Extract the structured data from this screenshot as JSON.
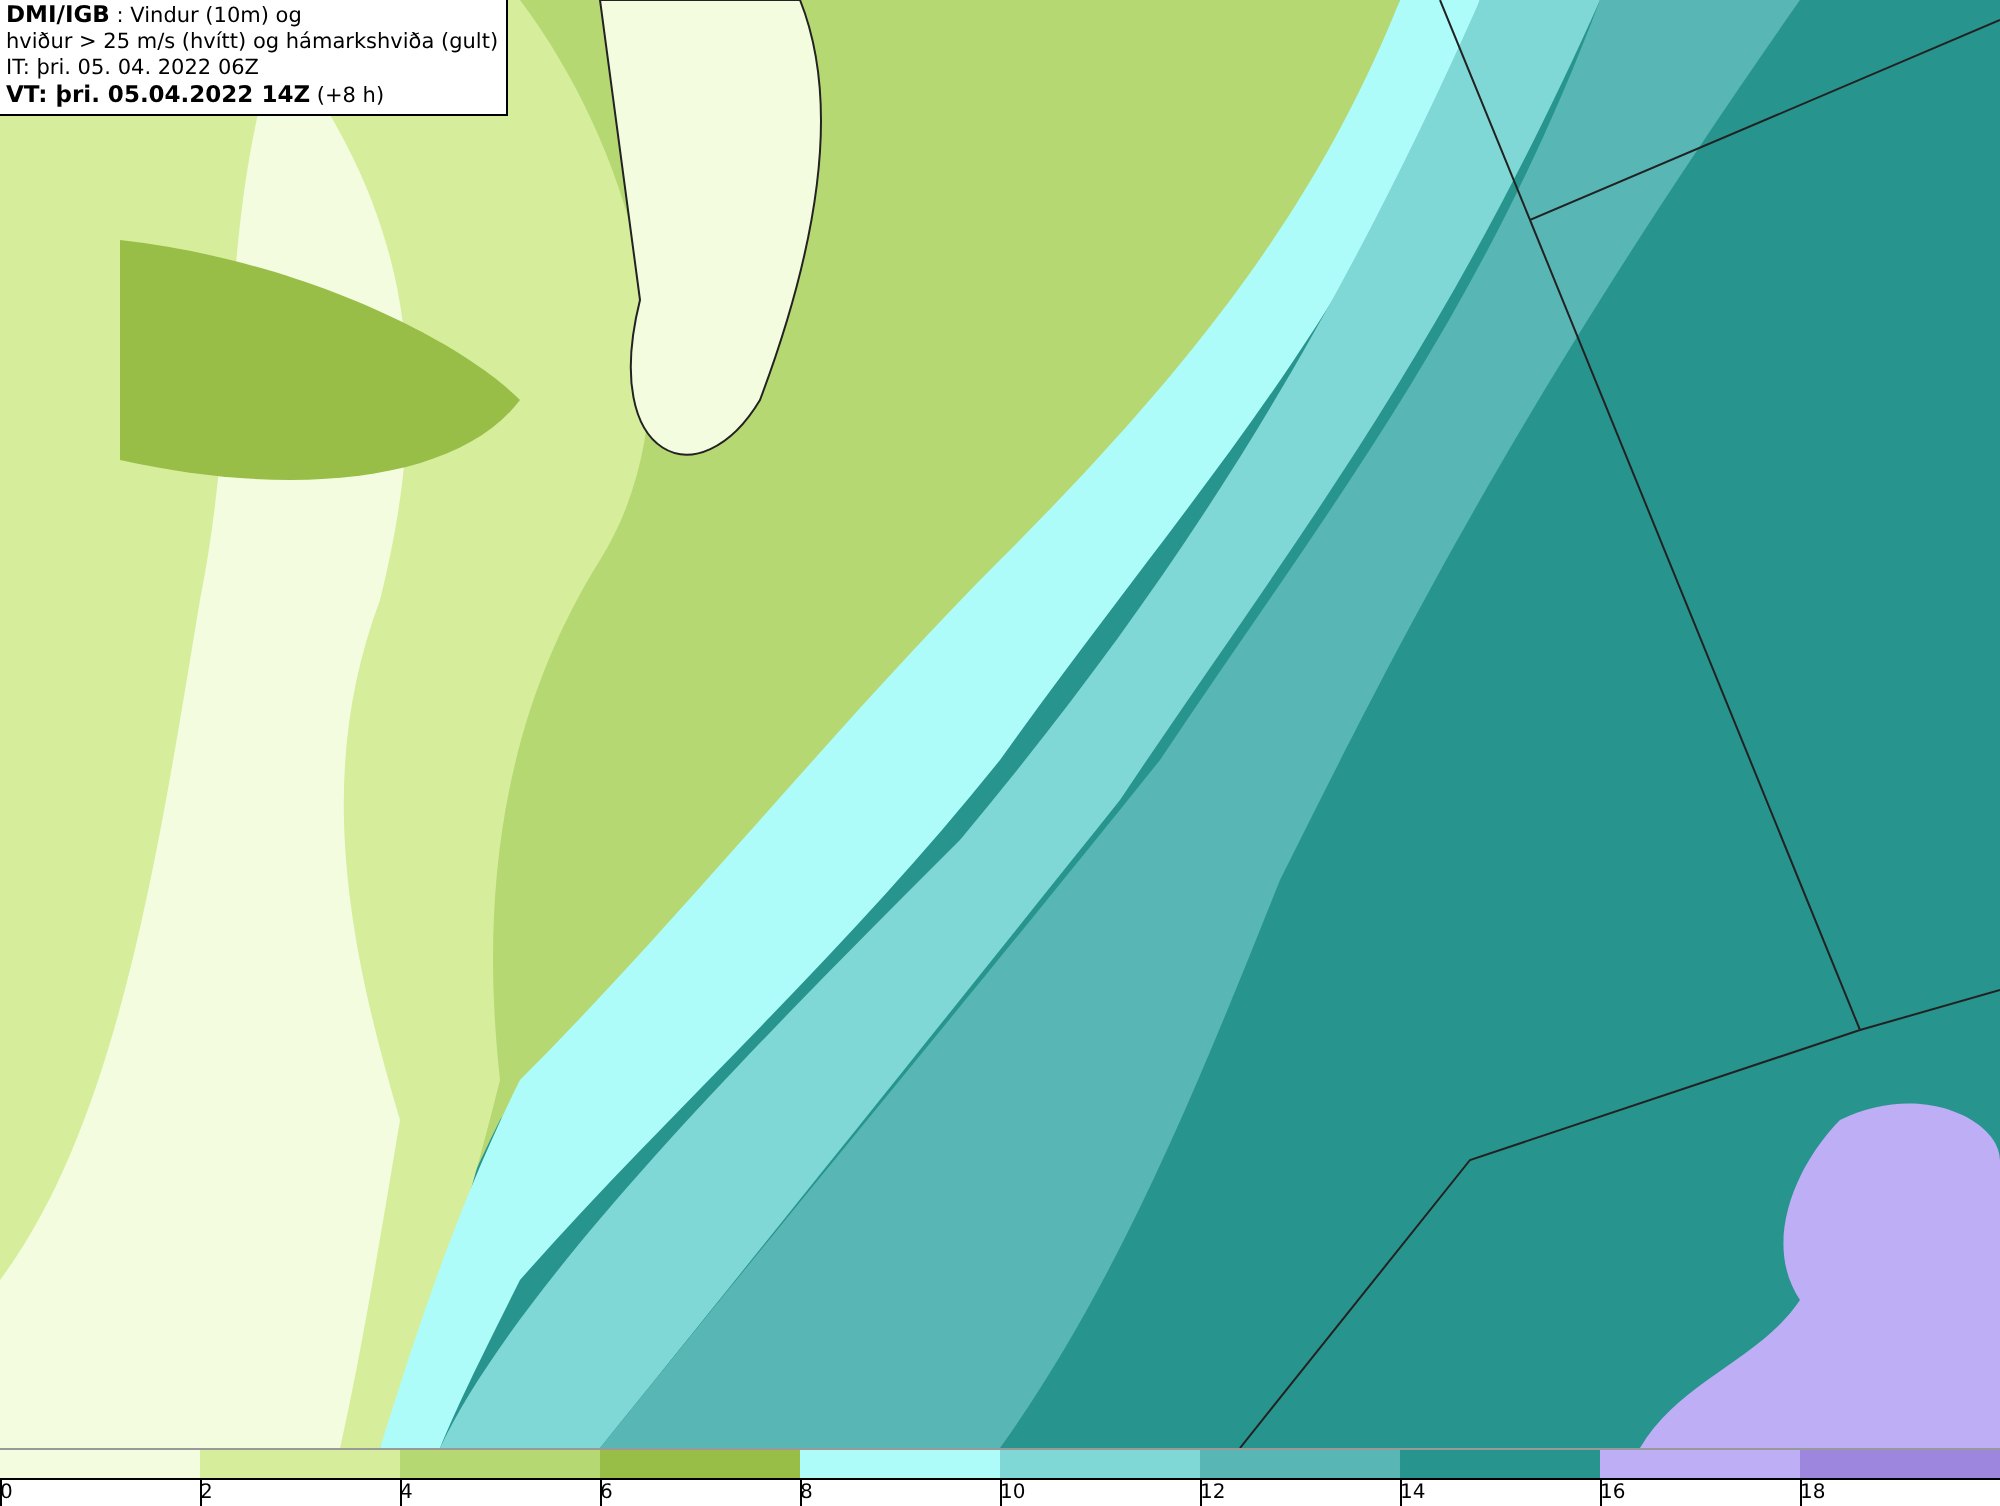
{
  "title_box": {
    "lines": [
      "**DMI/IGB** : Vindur (10m) og",
      "hviður > 25 m/s (hvítt) og hámarkshviða (gult)",
      "IT: þri. 05. 04. 2022 06Z",
      "**VT: þri. 05.04.2022 14Z** (+8 h)"
    ]
  },
  "legend": {
    "bins": [
      {
        "color": "#f4fce0"
      },
      {
        "color": "#d6ee9c"
      },
      {
        "color": "#b6d872"
      },
      {
        "color": "#98be48"
      },
      {
        "color": "#aefcfa"
      },
      {
        "color": "#80d8d6"
      },
      {
        "color": "#58b6b4"
      },
      {
        "color": "#28948e"
      },
      {
        "color": "#beaef6"
      },
      {
        "color": "#9c86de"
      }
    ],
    "ticks": [
      "0",
      "2",
      "4",
      "6",
      "8",
      "10",
      "12",
      "14",
      "16",
      "18"
    ]
  }
}
